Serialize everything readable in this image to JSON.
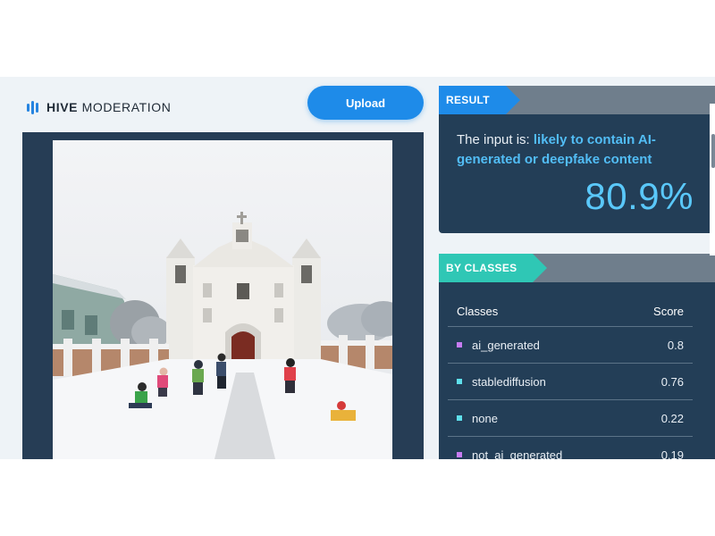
{
  "brand": {
    "strong": "HIVE",
    "light": "MODERATION",
    "color": "#2684e0"
  },
  "toolbar": {
    "upload_label": "Upload"
  },
  "image": {
    "alt": "uploaded image",
    "icons": [
      "snowy-church-photo"
    ]
  },
  "result": {
    "tag": "RESULT",
    "prefix": "The input is: ",
    "verdict": "likely to contain AI-generated or deepfake content",
    "score": "80.9%",
    "accent": "#52bdf5"
  },
  "by_classes": {
    "tag": "BY CLASSES",
    "columns": {
      "classes": "Classes",
      "score": "Score"
    },
    "rows": [
      {
        "name": "ai_generated",
        "score": "0.8",
        "color": "#c77cf2"
      },
      {
        "name": "stablediffusion",
        "score": "0.76",
        "color": "#5fe0ec"
      },
      {
        "name": "none",
        "score": "0.22",
        "color": "#5fe0ec"
      },
      {
        "name": "not_ai_generated",
        "score": "0.19",
        "color": "#c77cf2"
      }
    ]
  }
}
